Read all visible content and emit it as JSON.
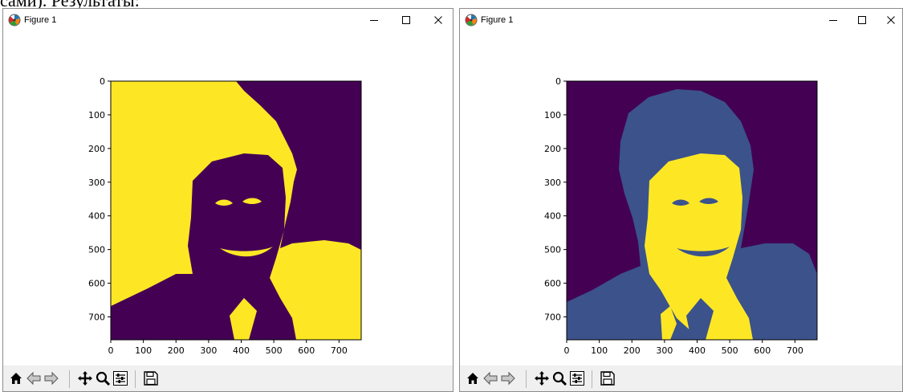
{
  "page_caption": "сами). Результаты:",
  "windows": [
    {
      "title": "Figure 1",
      "image_colors": {
        "low": "#440154",
        "high": "#fde725"
      },
      "axes": {
        "x_ticks": [
          "0",
          "100",
          "200",
          "300",
          "400",
          "500",
          "600",
          "700"
        ],
        "y_ticks": [
          "0",
          "100",
          "200",
          "300",
          "400",
          "500",
          "600",
          "700"
        ]
      }
    },
    {
      "title": "Figure 1",
      "image_colors": {
        "low": "#440154",
        "mid": "#3b528b",
        "high": "#fde725"
      },
      "axes": {
        "x_ticks": [
          "0",
          "100",
          "200",
          "300",
          "400",
          "500",
          "600",
          "700"
        ],
        "y_ticks": [
          "0",
          "100",
          "200",
          "300",
          "400",
          "500",
          "600",
          "700"
        ]
      }
    }
  ],
  "window_controls": [
    "minimize-icon",
    "maximize-icon",
    "close-icon"
  ],
  "toolbar_icons": [
    "home-icon",
    "back-icon",
    "forward-icon",
    "pan-icon",
    "zoom-icon",
    "subplots-icon",
    "save-icon"
  ]
}
